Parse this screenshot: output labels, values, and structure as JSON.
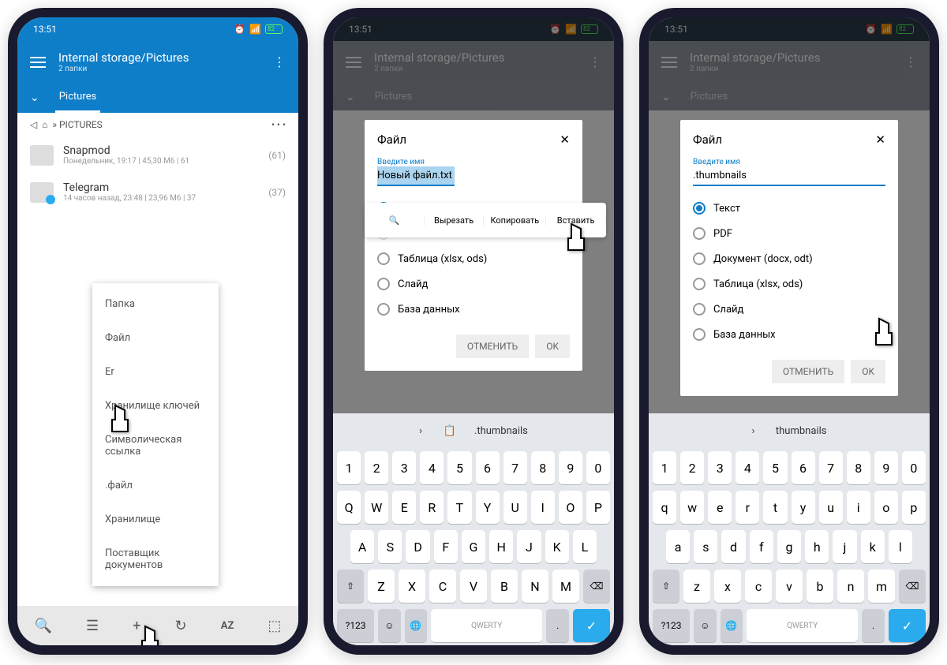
{
  "status": {
    "time": "13:51",
    "battery": "82"
  },
  "header": {
    "title": "Internal storage/Pictures",
    "subtitle": "2 папки",
    "tab": "Pictures",
    "crumb": "PICTURES"
  },
  "items": [
    {
      "name": "Snapmod",
      "meta": "Понедельник, 19:17 | 45,30 M6 | 61",
      "count": "(61)"
    },
    {
      "name": "Telegram",
      "meta": "14 часов назад, 23:48 | 23,96 M6 | 37",
      "count": "(37)"
    }
  ],
  "popup": [
    "Папка",
    "Файл",
    "Er",
    "Хранилище ключей",
    "Символическая ссылка",
    ".файл",
    "Хранилище",
    "Поставщик документов"
  ],
  "toolbar": {
    "az": "AZ"
  },
  "dialog": {
    "title": "Файл",
    "label": "Введите имя",
    "input2": "Новый файл.txt",
    "input3": ".thumbnails",
    "radios": [
      "Текст",
      "PDF",
      "Документ (docx, odt)",
      "Таблица (xlsx, ods)",
      "Слайд",
      "База данных"
    ],
    "cancel": "ОТМЕНИТЬ",
    "ok": "OK"
  },
  "context": {
    "search": "🔍",
    "cut": "Вырезать",
    "copy": "Копировать",
    "paste": "Вставить"
  },
  "kbd": {
    "sugg2": ".thumbnails",
    "sugg3": "thumbnails",
    "r1": [
      "1",
      "2",
      "3",
      "4",
      "5",
      "6",
      "7",
      "8",
      "9",
      "0"
    ],
    "r2u": [
      "Q",
      "W",
      "E",
      "R",
      "T",
      "Y",
      "U",
      "I",
      "O",
      "P"
    ],
    "r2l": [
      "q",
      "w",
      "e",
      "r",
      "t",
      "y",
      "u",
      "i",
      "o",
      "p"
    ],
    "r3u": [
      "A",
      "S",
      "D",
      "F",
      "G",
      "H",
      "J",
      "K",
      "L"
    ],
    "r3l": [
      "a",
      "s",
      "d",
      "f",
      "g",
      "h",
      "j",
      "k",
      "l"
    ],
    "r4u": [
      "Z",
      "X",
      "C",
      "V",
      "B",
      "N",
      "M"
    ],
    "r4l": [
      "z",
      "x",
      "c",
      "v",
      "b",
      "n",
      "m"
    ],
    "shift": "⇧",
    "bksp": "⌫",
    "num": "?123",
    "emo": "☺",
    "globe": "🌐",
    "space": "QWERTY",
    "go": "✓"
  }
}
